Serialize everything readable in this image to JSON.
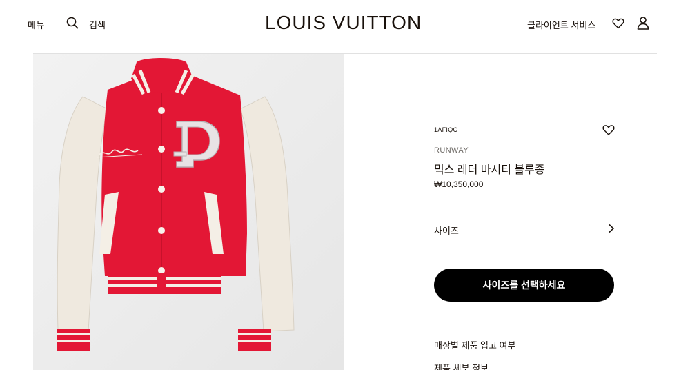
{
  "header": {
    "menu_label": "메뉴",
    "search_label": "검색",
    "brand": "LOUIS VUITTON",
    "client_service_label": "클라이언트 서비스",
    "icons": {
      "search": "search-icon",
      "wishlist": "heart-icon",
      "account": "user-icon"
    }
  },
  "product": {
    "sku": "1AFIQC",
    "collection": "RUNWAY",
    "name": "믹스 레더 바시티 블루종",
    "price": "₩10,350,000",
    "size_label": "사이즈",
    "cta_label": "사이즈를 선택하세요",
    "links": [
      "매장별 제품 입고 여부",
      "제품 세부 정보"
    ],
    "colors": {
      "jacket_body": "#e31735",
      "sleeves": "#efe9df",
      "cta": "#000000"
    }
  }
}
